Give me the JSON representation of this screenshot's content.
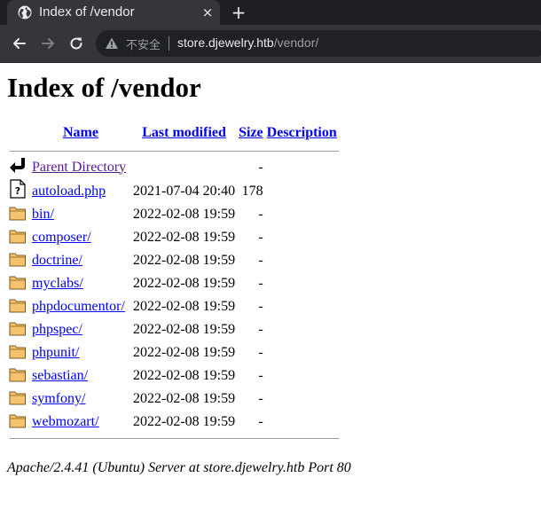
{
  "browser": {
    "tab_title": "Index of /vendor",
    "tab_close": "×",
    "new_tab": "+",
    "security_label": "不安全",
    "url_host": "store.djewelry.htb",
    "url_path": "/vendor/"
  },
  "page": {
    "heading": "Index of /vendor",
    "columns": {
      "name": "Name",
      "modified": "Last modified",
      "size": "Size",
      "description": "Description"
    },
    "parent": {
      "name": "Parent Directory",
      "size": "-"
    },
    "entries": [
      {
        "name": "autoload.php",
        "modified": "2021-07-04 20:40",
        "size": "178",
        "icon": "file-unknown-icon"
      },
      {
        "name": "bin/",
        "modified": "2022-02-08 19:59",
        "size": "-",
        "icon": "folder-icon"
      },
      {
        "name": "composer/",
        "modified": "2022-02-08 19:59",
        "size": "-",
        "icon": "folder-icon"
      },
      {
        "name": "doctrine/",
        "modified": "2022-02-08 19:59",
        "size": "-",
        "icon": "folder-icon"
      },
      {
        "name": "myclabs/",
        "modified": "2022-02-08 19:59",
        "size": "-",
        "icon": "folder-icon"
      },
      {
        "name": "phpdocumentor/",
        "modified": "2022-02-08 19:59",
        "size": "-",
        "icon": "folder-icon"
      },
      {
        "name": "phpspec/",
        "modified": "2022-02-08 19:59",
        "size": "-",
        "icon": "folder-icon"
      },
      {
        "name": "phpunit/",
        "modified": "2022-02-08 19:59",
        "size": "-",
        "icon": "folder-icon"
      },
      {
        "name": "sebastian/",
        "modified": "2022-02-08 19:59",
        "size": "-",
        "icon": "folder-icon"
      },
      {
        "name": "symfony/",
        "modified": "2022-02-08 19:59",
        "size": "-",
        "icon": "folder-icon"
      },
      {
        "name": "webmozart/",
        "modified": "2022-02-08 19:59",
        "size": "-",
        "icon": "folder-icon"
      }
    ],
    "footer": "Apache/2.4.41 (Ubuntu) Server at store.djewelry.htb Port 80"
  },
  "colors": {
    "link": "#0000ee",
    "visited_link": "#551a8b",
    "chrome_dark": "#35363a"
  }
}
